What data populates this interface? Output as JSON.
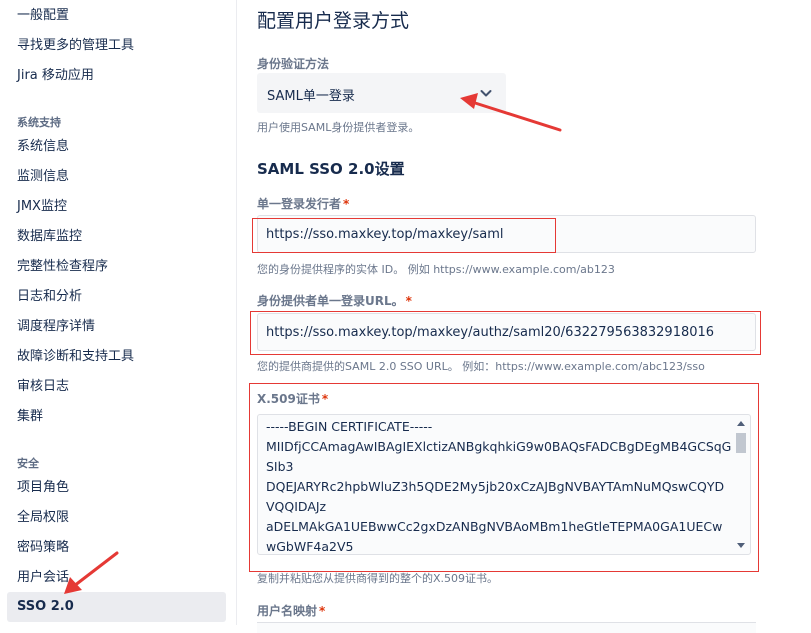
{
  "sidebar": {
    "items_top": [
      {
        "label": "一般配置",
        "name": "sidebar-item-general-config"
      },
      {
        "label": "寻找更多的管理工具",
        "name": "sidebar-item-more-admin-tools"
      },
      {
        "label": "Jira 移动应用",
        "name": "sidebar-item-jira-mobile"
      }
    ],
    "section_system": "系统支持",
    "items_system": [
      {
        "label": "系统信息",
        "name": "sidebar-item-system-info"
      },
      {
        "label": "监测信息",
        "name": "sidebar-item-monitoring"
      },
      {
        "label": "JMX监控",
        "name": "sidebar-item-jmx"
      },
      {
        "label": "数据库监控",
        "name": "sidebar-item-db-monitoring"
      },
      {
        "label": "完整性检查程序",
        "name": "sidebar-item-integrity-checker"
      },
      {
        "label": "日志和分析",
        "name": "sidebar-item-logging"
      },
      {
        "label": "调度程序详情",
        "name": "sidebar-item-scheduler"
      },
      {
        "label": "故障诊断和支持工具",
        "name": "sidebar-item-troubleshooting"
      },
      {
        "label": "审核日志",
        "name": "sidebar-item-audit-log"
      },
      {
        "label": "集群",
        "name": "sidebar-item-clustering"
      }
    ],
    "section_security": "安全",
    "items_security": [
      {
        "label": "项目角色",
        "name": "sidebar-item-project-roles"
      },
      {
        "label": "全局权限",
        "name": "sidebar-item-global-permissions"
      },
      {
        "label": "密码策略",
        "name": "sidebar-item-password-policy"
      },
      {
        "label": "用户会话",
        "name": "sidebar-item-user-sessions"
      }
    ],
    "active_item": "SSO 2.0"
  },
  "main": {
    "title": "配置用户登录方式",
    "auth_method": {
      "label": "身份验证方法",
      "value": "SAML单一登录",
      "help": "用户使用SAML身份提供者登录。"
    },
    "saml_section_title": "SAML SSO 2.0设置",
    "issuer": {
      "label": "单一登录发行者",
      "required": "*",
      "value": "https://sso.maxkey.top/maxkey/saml",
      "help": "您的身份提供程序的实体 ID。 例如 https://www.example.com/ab123"
    },
    "sso_url": {
      "label": "身份提供者单一登录URL。",
      "required": "*",
      "value": "https://sso.maxkey.top/maxkey/authz/saml20/632279563832918016",
      "help": "您的提供商提供的SAML 2.0 SSO URL。 例如：https://www.example.com/abc123/sso"
    },
    "certificate": {
      "label": "X.509证书",
      "required": "*",
      "lines": [
        "-----BEGIN CERTIFICATE-----",
        "MIIDfjCCAmagAwIBAgIEXlctizANBgkqhkiG9w0BAQsFADCBgDEgMB4GCSqG",
        "SIb3",
        "DQEJARYRc2hpbWluZ3h5QDE2My5jb20xCzAJBgNVBAYTAmNuMQswCQYD",
        "VQQIDAJz",
        "aDELMAkGA1UEBwwCc2gxDzANBgNVBAoMBm1heGtleTEPMA0GA1UECw",
        "wGbWF4a2V5"
      ],
      "help": "复制并粘贴您从提供商得到的整个的X.509证书。"
    },
    "username_mapping": {
      "label": "用户名映射",
      "required": "*"
    }
  },
  "colors": {
    "annotation_red": "#e53935",
    "required_red": "#de350b",
    "active_bg": "#ebecf0"
  }
}
